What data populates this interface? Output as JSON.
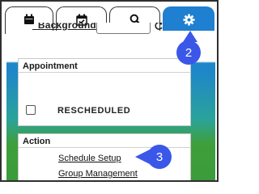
{
  "tabs": [
    {
      "name": "calendar",
      "icon": "calendar-icon"
    },
    {
      "name": "tasks",
      "icon": "calendar-check-icon"
    },
    {
      "name": "search",
      "icon": "search-icon"
    },
    {
      "name": "settings",
      "icon": "gear-icon",
      "active": true
    }
  ],
  "peek_label": "_Backgrounds",
  "appointment": {
    "title": "Appointment",
    "rescheduled_label": "RESCHEDULED",
    "rescheduled_checked": false
  },
  "action": {
    "title": "Action",
    "links": [
      "Schedule Setup",
      "Group Management"
    ]
  },
  "callouts": {
    "settings": "2",
    "schedule_setup": "3"
  },
  "colors": {
    "accent_blue": "#1f7fd0",
    "callout": "#3a57e8",
    "gradient_green": "#3f9f3a",
    "gradient_teal": "#2aa39a"
  }
}
